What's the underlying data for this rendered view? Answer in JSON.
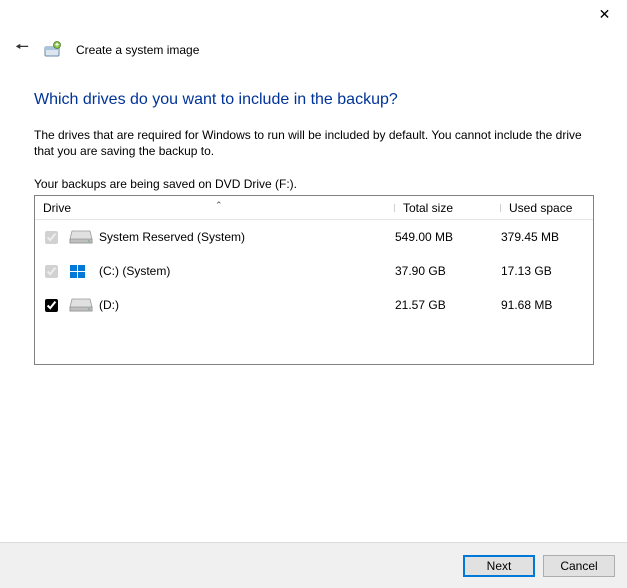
{
  "window": {
    "title": "Create a system image"
  },
  "page": {
    "heading": "Which drives do you want to include in the backup?",
    "description": "The drives that are required for Windows to run will be included by default. You cannot include the drive that you are saving the backup to.",
    "save_location_text": "Your backups are being saved on DVD Drive (F:)."
  },
  "table": {
    "headers": {
      "drive": "Drive",
      "total": "Total size",
      "used": "Used space"
    },
    "rows": [
      {
        "checked": true,
        "disabled": true,
        "icon": "hdd",
        "name": "System Reserved (System)",
        "total": "549.00 MB",
        "used": "379.45 MB"
      },
      {
        "checked": true,
        "disabled": true,
        "icon": "win",
        "name": "(C:) (System)",
        "total": "37.90 GB",
        "used": "17.13 GB"
      },
      {
        "checked": true,
        "disabled": false,
        "icon": "hdd",
        "name": "(D:)",
        "total": "21.57 GB",
        "used": "91.68 MB"
      }
    ]
  },
  "buttons": {
    "next": "Next",
    "cancel": "Cancel"
  }
}
